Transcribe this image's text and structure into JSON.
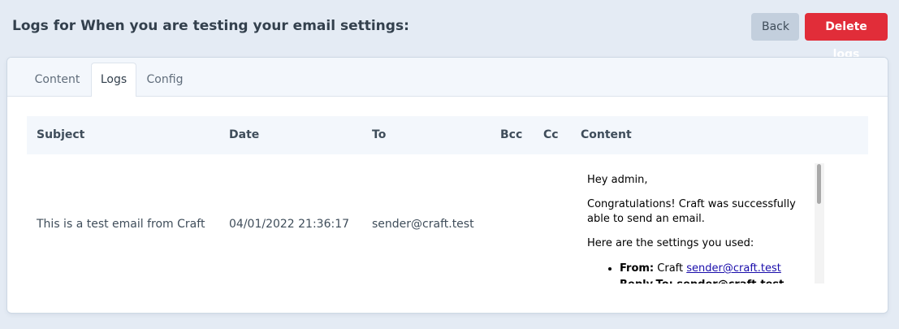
{
  "header": {
    "title": "Logs for When you are testing your email settings:",
    "back_label": "Back",
    "delete_label": "Delete logs"
  },
  "tabs": {
    "content": "Content",
    "logs": "Logs",
    "config": "Config",
    "active": "Logs"
  },
  "table": {
    "columns": [
      "Subject",
      "Date",
      "To",
      "Bcc",
      "Cc",
      "Content"
    ],
    "rows": [
      {
        "subject": "This is a test email from Craft",
        "date": "04/01/2022 21:36:17",
        "to": "sender@craft.test",
        "bcc": "",
        "cc": "",
        "content": {
          "greeting": "Hey admin,",
          "congrats": "Congratulations! Craft was successfully able to send an email.",
          "settings_intro": "Here are the settings you used:",
          "from_label": "From:",
          "from_name": "Craft",
          "from_email": "sender@craft.test",
          "reply_to_partial": "Reply-To: sender@craft.test"
        }
      }
    ]
  },
  "colors": {
    "page_bg": "#e4ebf4",
    "danger": "#e12d39",
    "secondary": "#c3cfdd",
    "link": "#1a0dab"
  }
}
